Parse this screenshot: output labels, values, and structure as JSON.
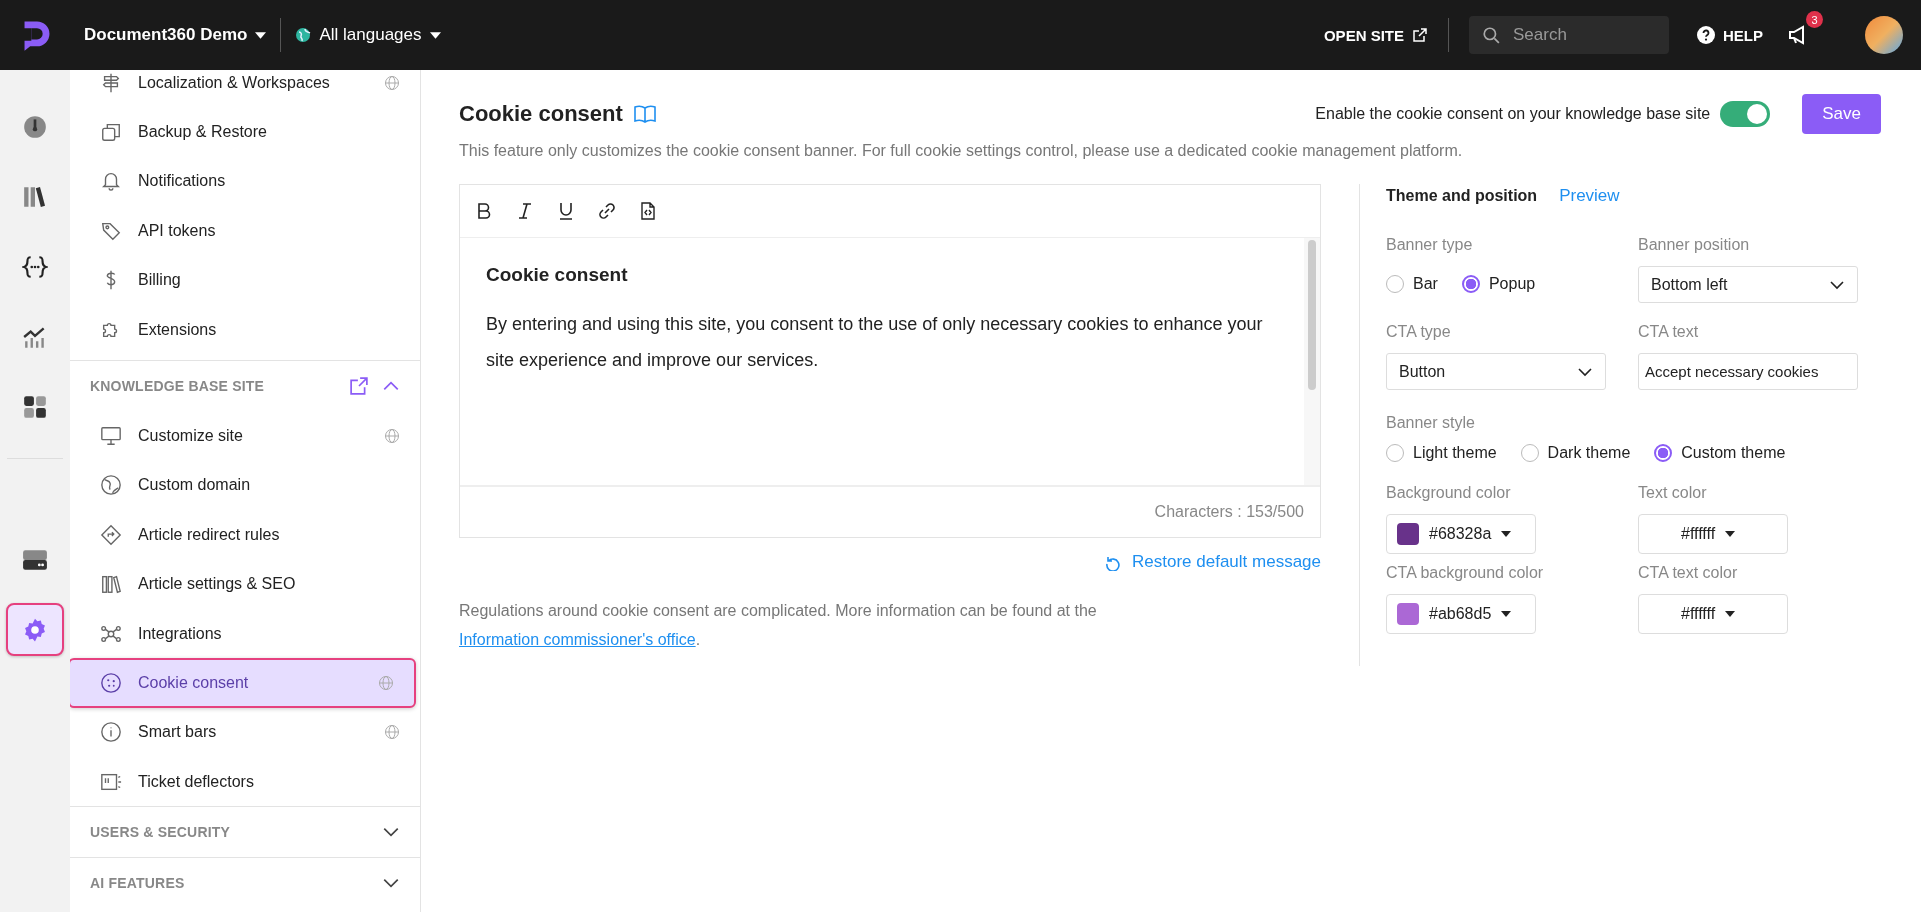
{
  "top_bar": {
    "project": "Document360 Demo",
    "language": "All languages",
    "open_site": "OPEN SITE",
    "search": {
      "placeholder": "Search"
    },
    "help": "HELP",
    "notifications": "3"
  },
  "rail": {
    "top": [
      {
        "selected": false
      },
      {
        "selected": false
      },
      {
        "selected": false
      },
      {
        "selected": false
      },
      {
        "selected": false
      }
    ],
    "bottom": [
      {
        "selected": false
      },
      {
        "selected": true
      }
    ]
  },
  "sidebar": {
    "items": [
      {
        "label": "Localization & Workspaces",
        "globe": true
      },
      {
        "label": "Backup & Restore",
        "globe": false
      },
      {
        "label": "Notifications",
        "globe": false
      },
      {
        "label": "API tokens",
        "globe": false
      },
      {
        "label": "Billing",
        "globe": false
      },
      {
        "label": "Extensions",
        "globe": false
      }
    ],
    "sections": [
      {
        "title": "KNOWLEDGE BASE SITE",
        "expanded": true,
        "items": [
          {
            "label": "Customize site",
            "globe": true,
            "selected": false
          },
          {
            "label": "Custom domain",
            "globe": false,
            "selected": false
          },
          {
            "label": "Article redirect rules",
            "globe": false,
            "selected": false
          },
          {
            "label": "Article settings & SEO",
            "globe": false,
            "selected": false
          },
          {
            "label": "Integrations",
            "globe": false,
            "selected": false
          },
          {
            "label": "Cookie consent",
            "globe": true,
            "selected": true
          },
          {
            "label": "Smart bars",
            "globe": true,
            "selected": false
          },
          {
            "label": "Ticket deflectors",
            "globe": false,
            "selected": false
          }
        ]
      },
      {
        "title": "USERS & SECURITY",
        "expanded": false
      },
      {
        "title": "AI FEATURES",
        "expanded": false
      }
    ]
  },
  "page": {
    "title": "Cookie consent",
    "description": "This feature only customizes the cookie consent banner. For full cookie settings control, please use a dedicated cookie management platform.",
    "toggle": {
      "label": "Enable the cookie consent on your knowledge base site",
      "on": true
    },
    "save": "Save",
    "editor": {
      "heading": "Cookie consent",
      "body": "By entering and using this site, you consent to the use of only necessary cookies to enhance your site experience and improve our services.",
      "counter": "Characters : 153/500"
    },
    "restore": "Restore default message",
    "note": "Regulations around cookie consent are complicated. More information can be found at the",
    "note_link": "Information commissioner's office",
    "note_end": "."
  },
  "settings": {
    "title": "Theme and position",
    "preview": "Preview",
    "banner_type": {
      "label": "Banner type",
      "options": [
        {
          "label": "Bar",
          "selected": false
        },
        {
          "label": "Popup",
          "selected": true
        }
      ]
    },
    "banner_position": {
      "label": "Banner position",
      "value": "Bottom left"
    },
    "cta_type": {
      "label": "CTA type",
      "value": "Button"
    },
    "cta_text": {
      "label": "CTA text",
      "value": "Accept necessary cookies"
    },
    "banner_style": {
      "label": "Banner style",
      "options": [
        {
          "label": "Light theme",
          "selected": false
        },
        {
          "label": "Dark theme",
          "selected": false
        },
        {
          "label": "Custom theme",
          "selected": true
        }
      ]
    },
    "colors": [
      {
        "label": "Background color",
        "value": "#68328a"
      },
      {
        "label": "Text color",
        "value": "#ffffff"
      },
      {
        "label": "CTA background color",
        "value": "#ab68d5"
      },
      {
        "label": "CTA text color",
        "value": "#ffffff"
      }
    ]
  }
}
